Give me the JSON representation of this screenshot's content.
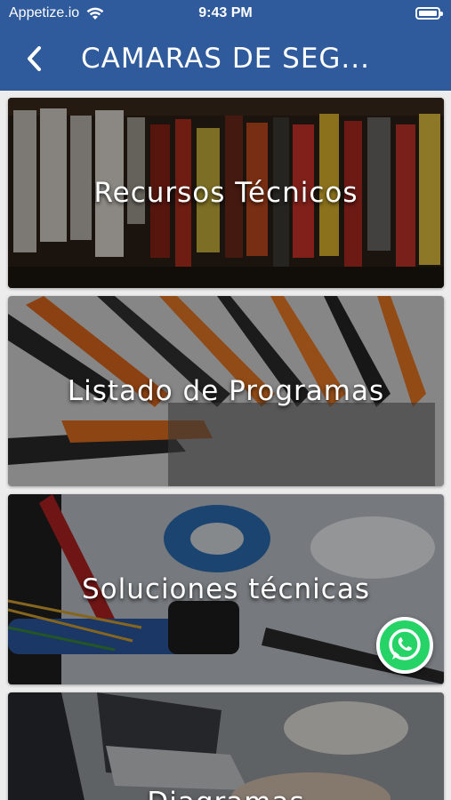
{
  "status_bar": {
    "carrier": "Appetize.io",
    "time": "9:43 PM",
    "icons": [
      "wifi-icon",
      "battery-icon"
    ]
  },
  "nav": {
    "title": "CAMARAS DE SEG...",
    "back_icon": "chevron-left-icon"
  },
  "cards": [
    {
      "label": "Recursos Técnicos"
    },
    {
      "label": "Listado de Programas"
    },
    {
      "label": "Soluciones técnicas"
    },
    {
      "label": "Diagramas"
    }
  ],
  "floating_button": {
    "icon": "whatsapp-icon"
  },
  "colors": {
    "header": "#2f5a9c",
    "whatsapp": "#25d366",
    "background": "#ececec"
  }
}
